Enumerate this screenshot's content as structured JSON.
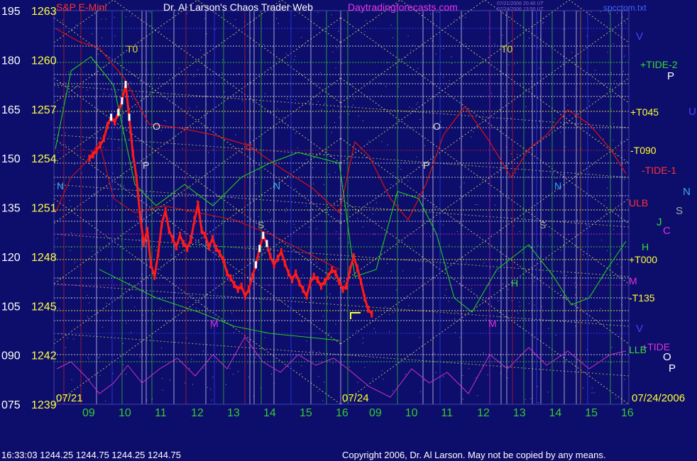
{
  "header": {
    "instrument": "S&P E-Mini",
    "title": "Dr. Al Larson's Chaos Trader Web",
    "site": "Daytradingforecasts.com",
    "stamp_line1": "07/21/2006 20:40 UT",
    "stamp_line2": "07/24/2006 13:50 UT",
    "file": "spcctom.txt"
  },
  "footer": {
    "quote": "16:33:03  1244.25 1244.75 1244.25 1244.75",
    "copyright": "Copyright 2006, Dr. Al Larson. May not be copied by any means."
  },
  "colors": {
    "background": "#0d0d6b",
    "price": "#ff1a1a",
    "price_white": "#ffffff",
    "red_line": "#dd1111",
    "green_line": "#22cc22",
    "magenta_line": "#cc33cc",
    "yellow_dots": "#e8e070",
    "session_white": "#e0e0ff",
    "grid_yellow": "#e0e000"
  },
  "chart_data": {
    "type": "line",
    "title": "S&P E-Mini",
    "ylim": [
      1239,
      1263
    ],
    "y_ticks": [
      1239,
      1242,
      1245,
      1248,
      1251,
      1254,
      1257,
      1260,
      1263
    ],
    "oscillator_ticks": [
      "075",
      "090",
      "105",
      "120",
      "135",
      "150",
      "165",
      "180",
      "195"
    ],
    "x_ticks": [
      "09",
      "10",
      "11",
      "12",
      "13",
      "14",
      "15",
      "16",
      "09",
      "10",
      "11",
      "12",
      "13",
      "14",
      "15",
      "16"
    ],
    "date_labels": [
      "07/21",
      "07/24",
      "07/24/2006"
    ],
    "level_labels": [
      {
        "name": "+TIDE-2",
        "color": "#33dd33"
      },
      {
        "name": "+T045",
        "color": "#ffff33"
      },
      {
        "name": "-T090",
        "color": "#ffff33"
      },
      {
        "name": "-TIDE-1",
        "color": "#ff3333"
      },
      {
        "name": "ULB",
        "color": "#ff3333"
      },
      {
        "name": "H",
        "color": "#33dd33"
      },
      {
        "name": "+T000",
        "color": "#ffff33"
      },
      {
        "name": "M",
        "color": "#dd33dd"
      },
      {
        "name": "-T135",
        "color": "#ffff33"
      },
      {
        "name": "+TIDE",
        "color": "#dd33dd"
      },
      {
        "name": "LLB",
        "color": "#33dd33"
      }
    ],
    "side_letters": [
      {
        "name": "V",
        "color": "#4444ff"
      },
      {
        "name": "P",
        "color": "#ffffff"
      },
      {
        "name": "U",
        "color": "#4444ff"
      },
      {
        "name": "N",
        "color": "#33aaee"
      },
      {
        "name": "S",
        "color": "#aaaaaa"
      },
      {
        "name": "J",
        "color": "#33dd33"
      },
      {
        "name": "C",
        "color": "#dd33dd"
      },
      {
        "name": "V",
        "color": "#4444ff"
      },
      {
        "name": "O",
        "color": "#ffffff"
      },
      {
        "name": "P",
        "color": "#ffffff"
      }
    ],
    "chart_letters": [
      {
        "name": "T0",
        "color": "#dddd33"
      },
      {
        "name": "O",
        "color": "#dddddd"
      },
      {
        "name": "P",
        "color": "#dddddd"
      },
      {
        "name": "N",
        "color": "#33aaee"
      },
      {
        "name": "C",
        "color": "#cc2222"
      },
      {
        "name": "S",
        "color": "#aaaaaa"
      },
      {
        "name": "M",
        "color": "#dd33dd"
      },
      {
        "name": "T0",
        "color": "#dddd33"
      },
      {
        "name": "O",
        "color": "#dddddd"
      },
      {
        "name": "P",
        "color": "#dddddd"
      },
      {
        "name": "N",
        "color": "#33aaee"
      },
      {
        "name": "S",
        "color": "#aaaaaa"
      },
      {
        "name": "H",
        "color": "#33dd33"
      },
      {
        "name": "M",
        "color": "#dd33dd"
      },
      {
        "name": "N",
        "color": "#33aaee"
      }
    ],
    "series": [
      {
        "name": "price",
        "x": [
          0,
          0.1,
          0.2,
          0.3,
          0.4,
          0.5,
          0.6,
          0.7,
          0.8,
          0.9,
          1.0,
          1.1,
          1.2,
          1.3,
          1.4,
          1.5,
          1.6,
          1.7,
          1.8,
          1.9,
          2.0,
          2.1,
          2.2,
          2.3,
          2.4,
          2.5,
          2.6,
          2.7,
          2.8,
          2.9,
          3.0,
          3.1,
          3.2,
          3.3,
          3.4,
          3.5,
          3.6,
          3.7,
          3.8,
          3.9,
          4.0,
          4.1,
          4.2,
          4.3,
          4.4,
          4.5,
          4.6,
          4.7,
          4.8,
          4.9,
          5.0,
          5.1,
          5.2,
          5.3,
          5.4,
          5.5,
          5.6,
          5.7,
          5.8,
          5.9,
          6.0,
          6.1,
          6.2,
          6.3,
          6.4,
          6.5,
          6.6,
          6.7,
          6.8,
          6.9,
          7.0,
          7.1,
          7.2,
          7.3,
          7.4,
          7.5,
          7.6,
          7.7,
          7.8
        ],
        "values": [
          1254,
          1254.2,
          1254.5,
          1254.8,
          1255.2,
          1256,
          1256.5,
          1256.2,
          1256.8,
          1257.5,
          1258.5,
          1256.5,
          1254.3,
          1252.8,
          1250.5,
          1248.8,
          1249.6,
          1247.5,
          1246.8,
          1248.2,
          1250,
          1250.8,
          1249.6,
          1249.1,
          1248.6,
          1249.3,
          1248.8,
          1248.5,
          1249.0,
          1250.2,
          1251.2,
          1249.6,
          1249.3,
          1248.6,
          1249.1,
          1248.5,
          1248.2,
          1247.8,
          1247.0,
          1246.7,
          1246.3,
          1246.0,
          1246.2,
          1245.6,
          1246.0,
          1246.8,
          1247.5,
          1248.5,
          1249.3,
          1248.8,
          1248.0,
          1247.5,
          1247.9,
          1248.3,
          1247.6,
          1247.0,
          1246.6,
          1247.0,
          1246.4,
          1246.0,
          1245.6,
          1246.4,
          1246.8,
          1246.6,
          1246.2,
          1246.5,
          1246.8,
          1247.2,
          1247.0,
          1246.5,
          1246.0,
          1246.2,
          1247.2,
          1248.0,
          1247.3,
          1246.5,
          1245.5,
          1244.8,
          1244.5
        ]
      }
    ],
    "grid": true
  }
}
